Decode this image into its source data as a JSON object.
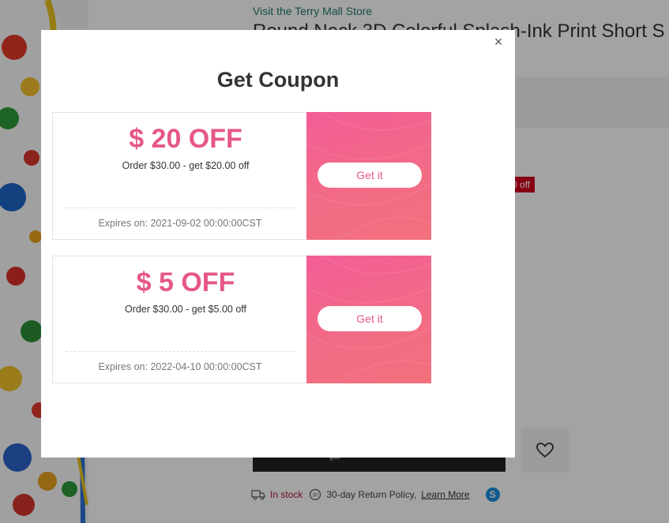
{
  "background_page": {
    "store_link": "Visit the Terry Mall Store",
    "product_title": "Round Neck 3D Colorful Splash-Ink Print Short S",
    "discount_badge": ".00 off",
    "stock_status": "In stock",
    "return_policy": "30-day Return Policy,",
    "learn_more": "Learn More",
    "skype_letter": "S"
  },
  "modal": {
    "title": "Get Coupon",
    "close_label": "×",
    "coupons": [
      {
        "amount": "$ 20 OFF",
        "description": "Order $30.00 - get $20.00 off",
        "expiry": "Expires on: 2021-09-02 00:00:00CST",
        "button_label": "Get it"
      },
      {
        "amount": "$ 5 OFF",
        "description": "Order $30.00 - get $5.00 off",
        "expiry": "Expires on: 2022-04-10 00:00:00CST",
        "button_label": "Get it"
      }
    ]
  },
  "colors": {
    "accent_pink": "#e5578a",
    "coupon_gradient_start": "#f35d97",
    "coupon_gradient_end": "#f3707c",
    "store_link": "#1f7a6a",
    "badge_red": "#d0021b"
  },
  "icons": {
    "close": "close-icon",
    "wishlist": "heart-icon",
    "delivery": "truck-icon",
    "return": "return-policy-icon",
    "chat": "skype-icon"
  }
}
